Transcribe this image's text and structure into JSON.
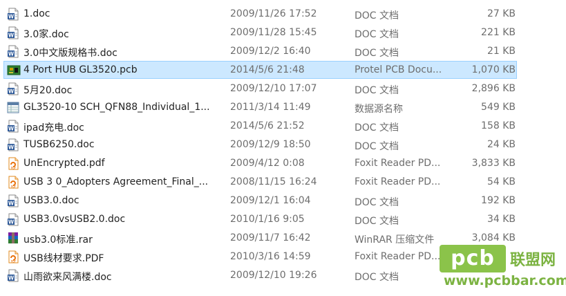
{
  "files": [
    {
      "name": "1.doc",
      "date": "2009/11/26 17:52",
      "type": "DOC 文档",
      "size": "27 KB",
      "icon": "word-doc-icon"
    },
    {
      "name": "3.0家.doc",
      "date": "2009/11/28 15:45",
      "type": "DOC 文档",
      "size": "221 KB",
      "icon": "word-doc-icon"
    },
    {
      "name": "3.0中文版规格书.doc",
      "date": "2009/12/2 16:40",
      "type": "DOC 文档",
      "size": "21 KB",
      "icon": "word-doc-icon"
    },
    {
      "name": "4 Port HUB GL3520.pcb",
      "date": "2014/5/6 21:48",
      "type": "Protel PCB Docu...",
      "size": "1,070 KB",
      "icon": "pcb-file-icon",
      "selected": true
    },
    {
      "name": "5月20.doc",
      "date": "2009/12/10 17:07",
      "type": "DOC 文档",
      "size": "2,896 KB",
      "icon": "word-doc-icon"
    },
    {
      "name": "GL3520-10 SCH_QFN88_Individual_1...",
      "date": "2011/3/14 11:49",
      "type": "数据源名称",
      "size": "549 KB",
      "icon": "data-source-icon"
    },
    {
      "name": "ipad充电.doc",
      "date": "2014/5/6 21:52",
      "type": "DOC 文档",
      "size": "158 KB",
      "icon": "word-doc-icon"
    },
    {
      "name": "TUSB6250.doc",
      "date": "2009/12/9 18:50",
      "type": "DOC 文档",
      "size": "24 KB",
      "icon": "word-doc-icon"
    },
    {
      "name": "UnEncrypted.pdf",
      "date": "2009/4/12 0:08",
      "type": "Foxit Reader PD...",
      "size": "3,833 KB",
      "icon": "pdf-icon"
    },
    {
      "name": "USB 3 0_Adopters Agreement_Final_...",
      "date": "2008/11/15 16:24",
      "type": "Foxit Reader PD...",
      "size": "54 KB",
      "icon": "pdf-icon"
    },
    {
      "name": "USB3.0.doc",
      "date": "2009/12/1 16:04",
      "type": "DOC 文档",
      "size": "192 KB",
      "icon": "word-doc-icon"
    },
    {
      "name": "USB3.0vsUSB2.0.doc",
      "date": "2010/1/16 9:05",
      "type": "DOC 文档",
      "size": "34 KB",
      "icon": "word-doc-icon"
    },
    {
      "name": "usb3.0标准.rar",
      "date": "2009/11/7 16:42",
      "type": "WinRAR 压缩文件",
      "size": "3,084 KB",
      "icon": "rar-archive-icon"
    },
    {
      "name": "USB线材要求.PDF",
      "date": "2010/3/16 14:59",
      "type": "Foxit Reader PD...",
      "size": "",
      "icon": "pdf-icon"
    },
    {
      "name": "山雨欲来风满楼.doc",
      "date": "2009/12/10 19:26",
      "type": "DOC 文档",
      "size": "",
      "icon": "word-doc-icon"
    }
  ],
  "watermark": {
    "logo": "pcb",
    "cn": "联盟网",
    "url": "www.pcbbar.com"
  }
}
